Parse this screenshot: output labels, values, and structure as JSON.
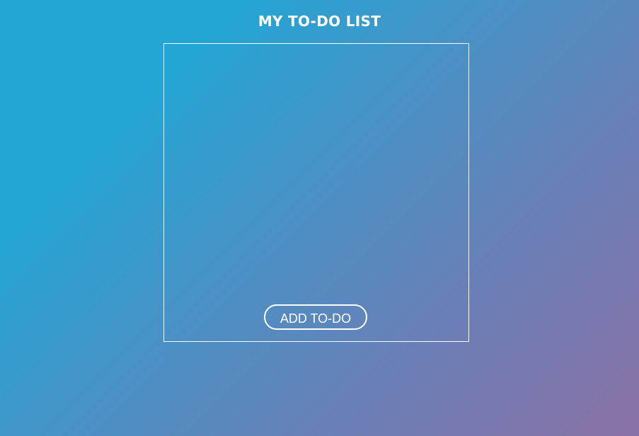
{
  "header": {
    "title": "MY TO-DO LIST"
  },
  "todo_panel": {
    "items": [],
    "add_button_label": "ADD TO-DO"
  },
  "colors": {
    "gradient_start": "#23a6d5",
    "gradient_mid": "#6b7fb6",
    "gradient_end": "#8a71a6",
    "foreground": "#ffffff"
  }
}
